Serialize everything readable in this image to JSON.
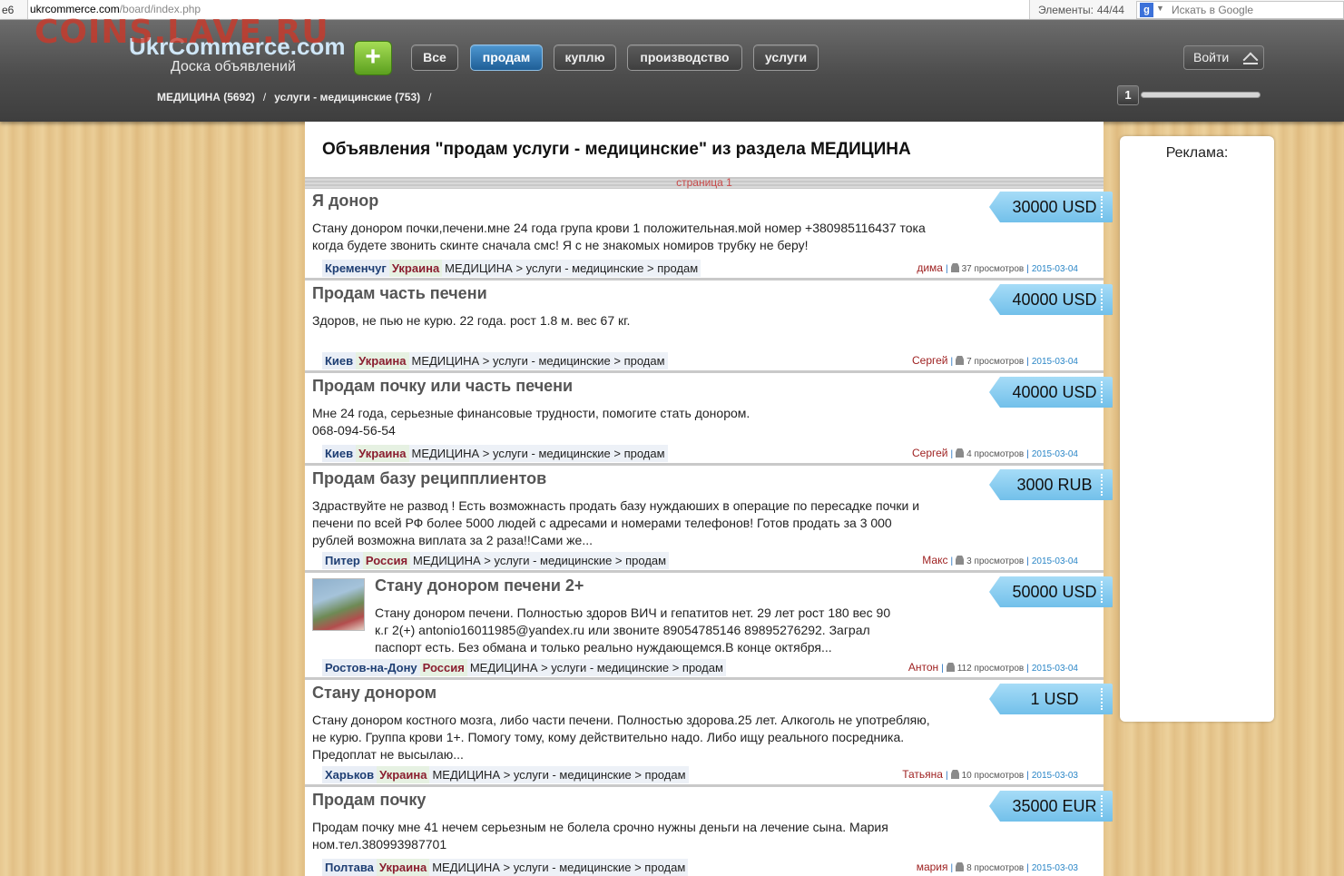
{
  "browser": {
    "left_fragment": "e6",
    "url_domain": "ukrcommerce.com",
    "url_path": "/board/index.php",
    "elements_label": "Элементы:",
    "elements_count": "44/44",
    "search_placeholder": "Искать в Google"
  },
  "watermark": "COINS.LAVE.RU",
  "header": {
    "logo": "UkrCommerce.com",
    "tagline": "Доска объявлений",
    "add_button": "+",
    "categories": [
      "Все",
      "продам",
      "куплю",
      "производство",
      "услуги"
    ],
    "active_category": "продам",
    "login": "Войти",
    "breadcrumb": [
      "МЕДИЦИНА (5692)",
      "услуги - медицинские (753)"
    ],
    "breadcrumb_sep": "/",
    "page_number": "1"
  },
  "main": {
    "heading": "Объявления \"продам услуги - медицинские\" из раздела МЕДИЦИНА",
    "page_label": "страница 1"
  },
  "ads": [
    {
      "title": "Я донор",
      "price": "30000 USD",
      "desc": [
        "Стану донором почки,печени.мне 24 года група крови 1 положительная.мой номер +380985116437 тока",
        "когда будете звонить скинте сначала смс! Я с не знакомых номиров трубку не беру!"
      ],
      "city": "Кременчуг",
      "country": "Украина",
      "path": "МЕДИЦИНА > услуги - медицинские > продам",
      "author": "дима",
      "views": "37 просмотров",
      "date": "2015-03-04"
    },
    {
      "title": "Продам часть печени",
      "price": "40000 USD",
      "desc": [
        "Здоров, не пью не курю. 22 года. рост 1.8 м. вес 67 кг."
      ],
      "city": "Киев",
      "country": "Украина",
      "path": "МЕДИЦИНА > услуги - медицинские > продам",
      "author": "Сергей",
      "views": "7 просмотров",
      "date": "2015-03-04"
    },
    {
      "title": "Продам почку или часть печени",
      "price": "40000 USD",
      "desc": [
        "Мне 24 года, серьезные финансовые трудности, помогите стать донором.",
        "068-094-56-54"
      ],
      "city": "Киев",
      "country": "Украина",
      "path": "МЕДИЦИНА > услуги - медицинские > продам",
      "author": "Сергей",
      "views": "4 просмотров",
      "date": "2015-03-04"
    },
    {
      "title": "Продам базу реципплиентов",
      "price": "3000 RUB",
      "desc": [
        "Здраствуйте не развод ! Есть возможнасть продать базу нуждаюших в операцие по пересадке почки и",
        "печени по всей РФ более 5000 людей с адресами и номерами телефонов! Готов продать за 3 000",
        "рублей возможна виплата за 2 раза!!Сами же..."
      ],
      "city": "Питер",
      "country": "Россия",
      "path": "МЕДИЦИНА > услуги - медицинские > продам",
      "author": "Макс",
      "views": "3 просмотров",
      "date": "2015-03-04"
    },
    {
      "title": "Стану донором печени 2+",
      "price": "50000 USD",
      "desc": [
        "Стану донором печени. Полностью здоров ВИЧ и гепатитов нет. 29 лет рост 180 вес 90",
        "к.г 2(+) antonio16011985@yandex.ru или звоните 89054785146 89895276292. Заграл",
        "паспорт есть. Без обмана и только реально нуждающемся.В конце октября..."
      ],
      "city": "Ростов-на-Дону",
      "country": "Россия",
      "path": "МЕДИЦИНА > услуги - медицинские > продам",
      "author": "Антон",
      "views": "112 просмотров",
      "date": "2015-03-04"
    },
    {
      "title": "Стану донором",
      "price": "1 USD",
      "desc": [
        "Стану донором костного мозга, либо части печени. Полностью здорова.25 лет. Алкоголь не употребляю,",
        "не курю. Группа крови 1+. Помогу тому, кому действительно надо. Либо ищу реального посредника.",
        "Предоплат не высылаю..."
      ],
      "city": "Харьков",
      "country": "Украина",
      "path": "МЕДИЦИНА > услуги - медицинские > продам",
      "author": "Татьяна",
      "views": "10 просмотров",
      "date": "2015-03-03"
    },
    {
      "title": "Продам почку",
      "price": "35000 EUR",
      "desc": [
        "Продам почку мне 41 нечем серьезным не болела срочно нужны деньги на лечение сына. Мария",
        "ном.тел.380993987701"
      ],
      "city": "Полтава",
      "country": "Украина",
      "path": "МЕДИЦИНА > услуги - медицинские > продам",
      "author": "мария",
      "views": "8 просмотров",
      "date": "2015-03-03"
    }
  ],
  "sidebar": {
    "title": "Реклама:"
  }
}
